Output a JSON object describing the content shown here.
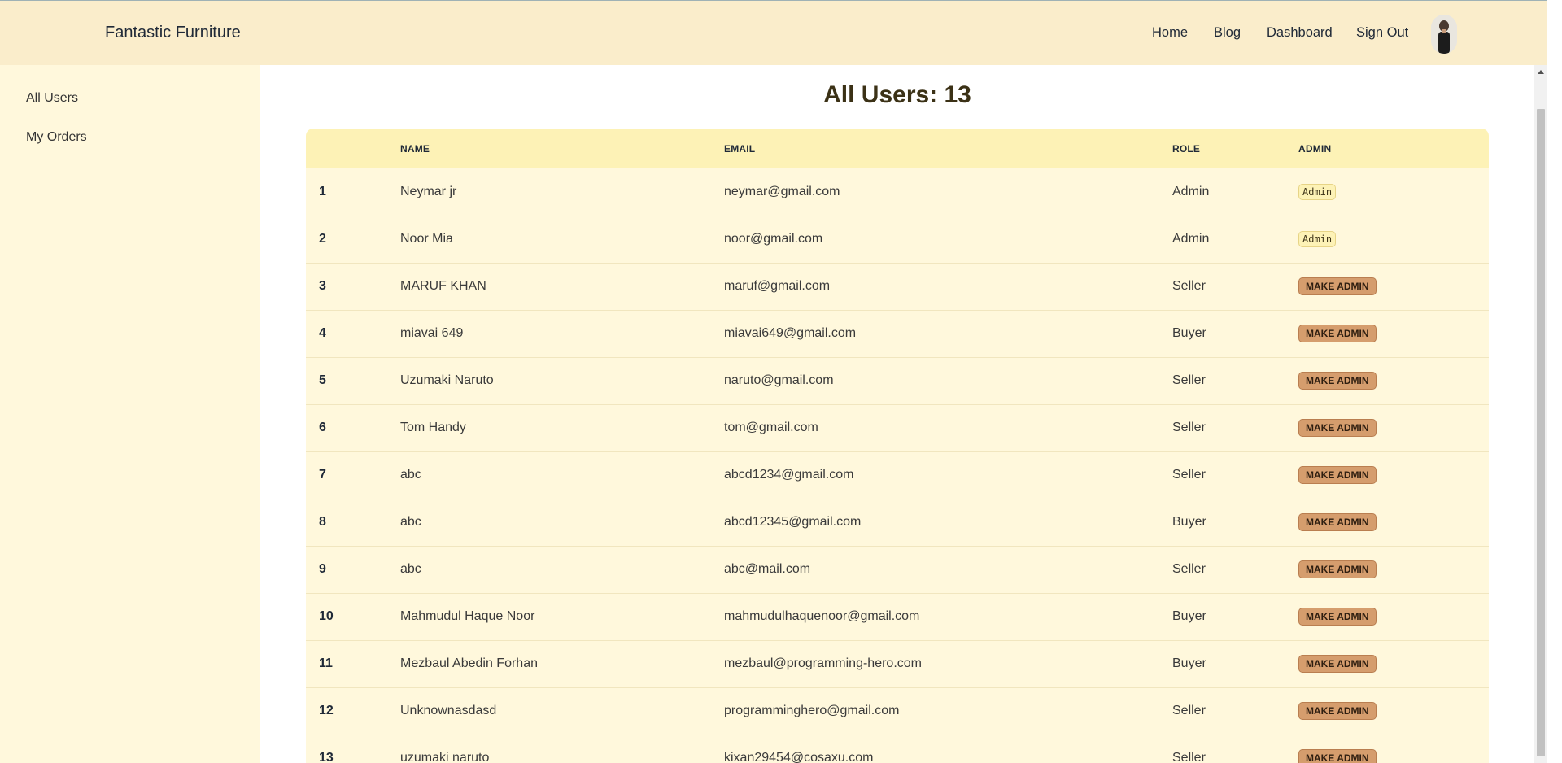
{
  "navbar": {
    "brand": "Fantastic Furniture",
    "links": [
      "Home",
      "Blog",
      "Dashboard",
      "Sign Out"
    ],
    "avatar_icon": "user-avatar"
  },
  "sidebar": {
    "items": [
      "All Users",
      "My Orders"
    ]
  },
  "main": {
    "title": "All Users: 13",
    "columns": [
      "",
      "Name",
      "Email",
      "Role",
      "Admin"
    ],
    "admin_label": "Admin",
    "make_admin_label": "Make Admin",
    "rows": [
      {
        "index": "1",
        "name": "Neymar jr",
        "email": "neymar@gmail.com",
        "role": "Admin",
        "is_admin": true
      },
      {
        "index": "2",
        "name": "Noor Mia",
        "email": "noor@gmail.com",
        "role": "Admin",
        "is_admin": true
      },
      {
        "index": "3",
        "name": "MARUF KHAN",
        "email": "maruf@gmail.com",
        "role": "Seller",
        "is_admin": false
      },
      {
        "index": "4",
        "name": "miavai 649",
        "email": "miavai649@gmail.com",
        "role": "Buyer",
        "is_admin": false
      },
      {
        "index": "5",
        "name": "Uzumaki Naruto",
        "email": "naruto@gmail.com",
        "role": "Seller",
        "is_admin": false
      },
      {
        "index": "6",
        "name": "Tom Handy",
        "email": "tom@gmail.com",
        "role": "Seller",
        "is_admin": false
      },
      {
        "index": "7",
        "name": "abc",
        "email": "abcd1234@gmail.com",
        "role": "Seller",
        "is_admin": false
      },
      {
        "index": "8",
        "name": "abc",
        "email": "abcd12345@gmail.com",
        "role": "Buyer",
        "is_admin": false
      },
      {
        "index": "9",
        "name": "abc",
        "email": "abc@mail.com",
        "role": "Seller",
        "is_admin": false
      },
      {
        "index": "10",
        "name": "Mahmudul Haque Noor",
        "email": "mahmudulhaquenoor@gmail.com",
        "role": "Buyer",
        "is_admin": false
      },
      {
        "index": "11",
        "name": "Mezbaul Abedin Forhan",
        "email": "mezbaul@programming-hero.com",
        "role": "Buyer",
        "is_admin": false
      },
      {
        "index": "12",
        "name": "Unknownasdasd",
        "email": "programminghero@gmail.com",
        "role": "Seller",
        "is_admin": false
      },
      {
        "index": "13",
        "name": "uzumaki naruto",
        "email": "kixan29454@cosaxu.com",
        "role": "Seller",
        "is_admin": false
      }
    ]
  },
  "colors": {
    "navbar_bg": "#faedcb",
    "sidebar_bg": "#fff8dc",
    "table_header_bg": "#fdf2b6",
    "make_admin_bg": "#d59d6d"
  }
}
